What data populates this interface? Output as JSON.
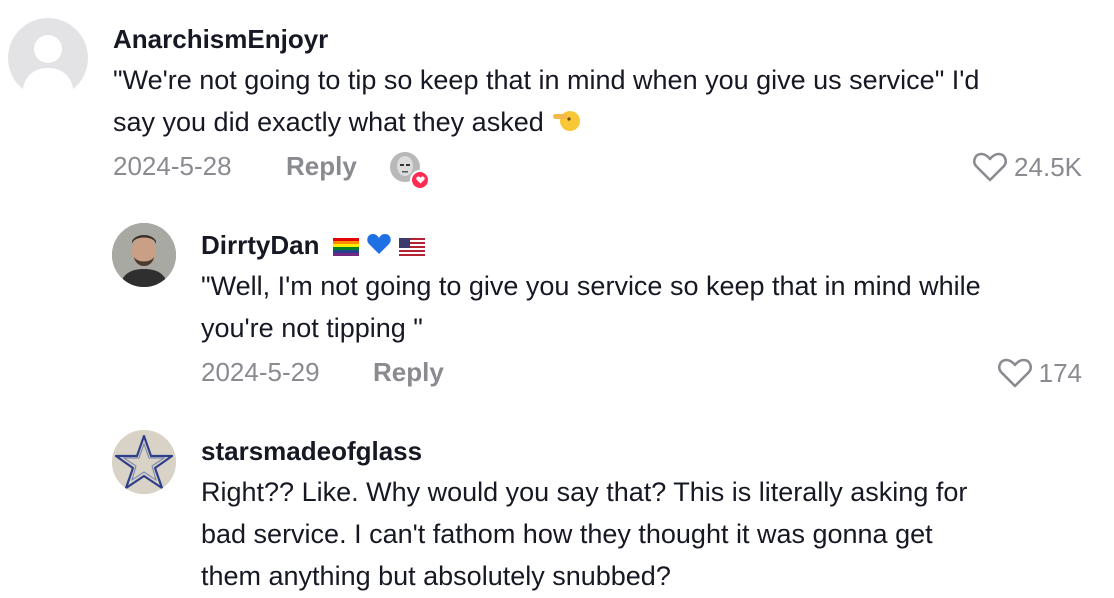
{
  "comments": [
    {
      "username": "AnarchismEnjoyr",
      "text_line1": "\"We're not going to tip so keep that in mind when you give us service\" I'd",
      "text_line2": "say you did exactly what they asked",
      "date": "2024-5-28",
      "reply_label": "Reply",
      "likes": "24.5K"
    },
    {
      "username": "DirrtyDan",
      "text_line1": "\"Well, I'm not going to give you service so keep that in mind while",
      "text_line2": "you're not tipping \"",
      "date": "2024-5-29",
      "reply_label": "Reply",
      "likes": "174"
    },
    {
      "username": "starsmadeofglass",
      "text_line1": "Right?? Like. Why would you say that? This is literally asking for",
      "text_line2": "bad service. I can't fathom how they thought it was gonna get",
      "text_line3": "them anything but absolutely snubbed?"
    }
  ],
  "colors": {
    "text": "#161823",
    "muted": "#8a8b91",
    "liked_badge": "#fe2c55"
  }
}
